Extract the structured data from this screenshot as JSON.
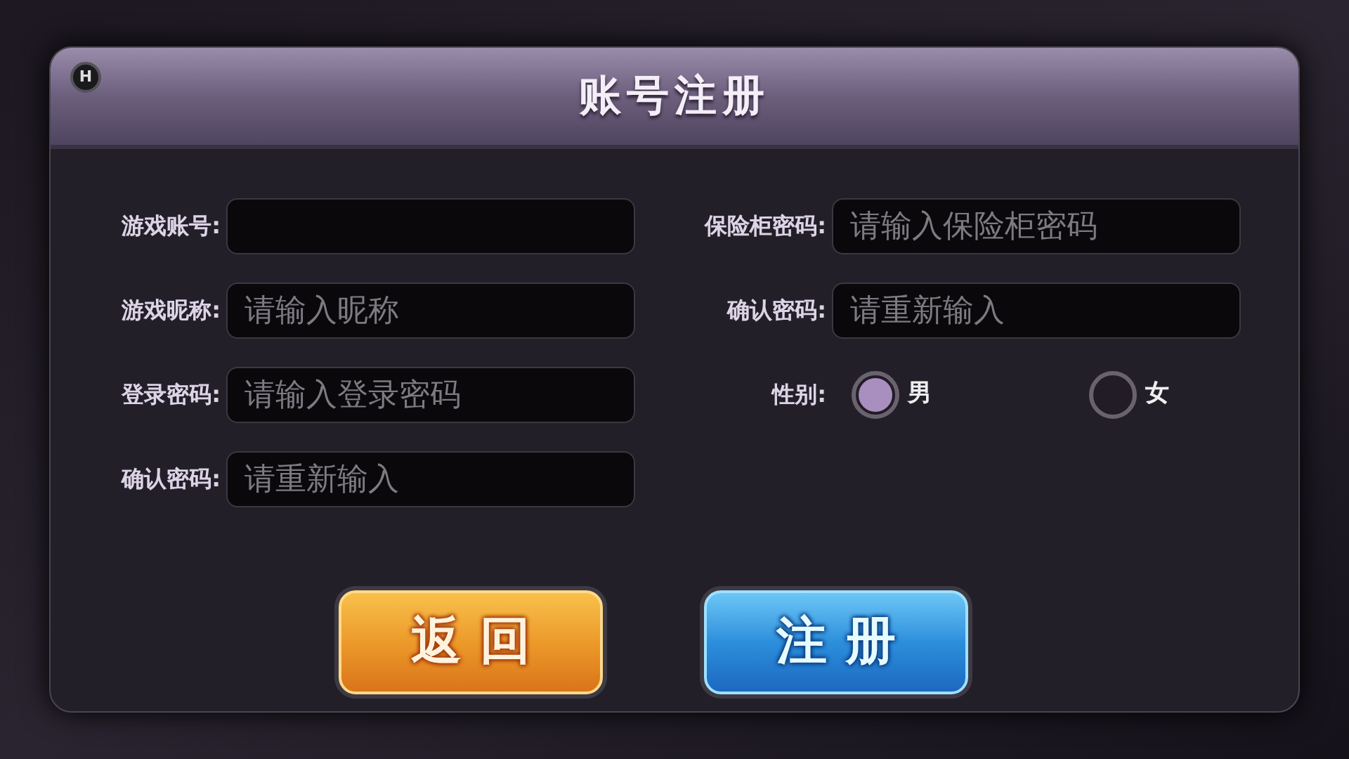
{
  "dialog": {
    "badge": "H",
    "title": "账号注册"
  },
  "left_fields": [
    {
      "label": "游戏账号:"
    },
    {
      "label": "游戏昵称:",
      "placeholder": "请输入昵称"
    },
    {
      "label": "登录密码:",
      "placeholder": "请输入登录密码"
    },
    {
      "label": "确认密码:",
      "placeholder": "请重新输入"
    }
  ],
  "right_fields": [
    {
      "label": "保险柜密码:",
      "placeholder": "请输入保险柜密码"
    },
    {
      "label": "确认密码:",
      "placeholder": "请重新输入"
    }
  ],
  "gender": {
    "label": "性别:",
    "options": [
      {
        "label": "男",
        "selected": true
      },
      {
        "label": "女",
        "selected": false
      }
    ]
  },
  "buttons": [
    {
      "label": "返 回",
      "kind": "back"
    },
    {
      "label": "注 册",
      "kind": "register"
    }
  ]
}
